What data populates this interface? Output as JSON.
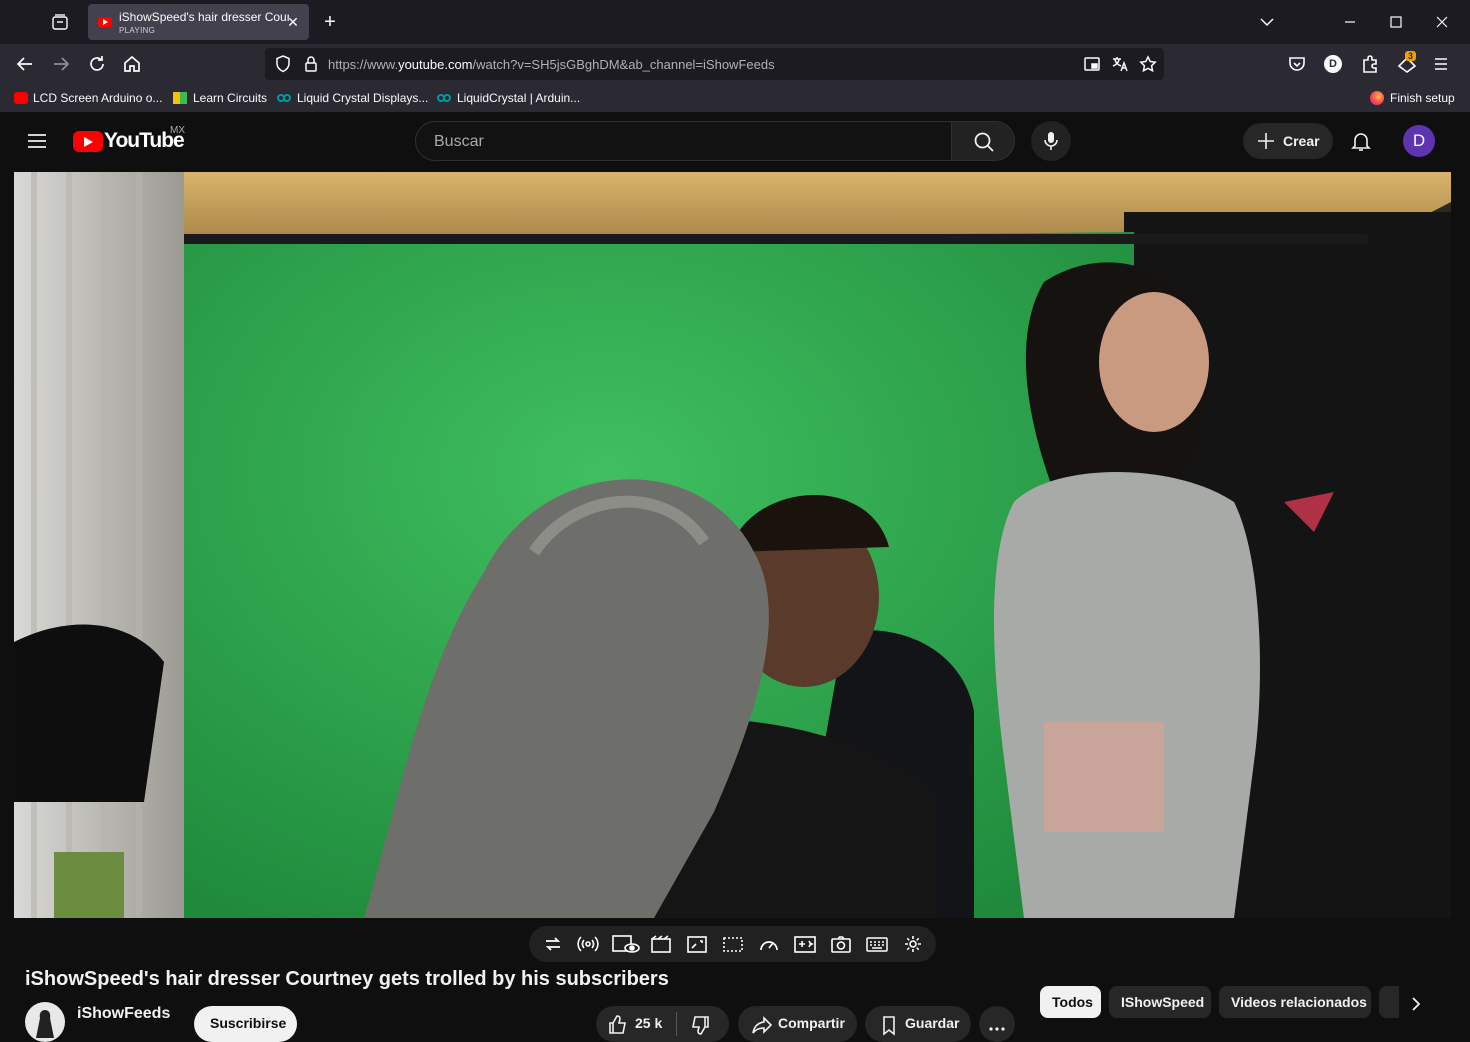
{
  "browser": {
    "tab": {
      "title": "iShowSpeed's hair dresser Courtney gets trolled by his subscribers",
      "status": "PLAYING"
    },
    "url": {
      "prefix": "https://www.",
      "domain": "youtube.com",
      "path": "/watch?v=SH5jsGBghDM&ab_channel=iShowFeeds"
    },
    "account_initial": "D",
    "extension_badge": "3",
    "bookmarks": [
      {
        "label": "LCD Screen Arduino o...",
        "icon": "youtube-favicon"
      },
      {
        "label": "Learn Circuits",
        "icon": "learn-circuits-favicon"
      },
      {
        "label": "Liquid Crystal Displays...",
        "icon": "arduino-favicon"
      },
      {
        "label": "LiquidCrystal | Arduin...",
        "icon": "arduino-favicon"
      }
    ],
    "finish_setup": "Finish setup"
  },
  "youtube": {
    "logo_text": "YouTube",
    "country_code": "MX",
    "search_placeholder": "Buscar",
    "create_label": "Crear",
    "avatar_initial": "D"
  },
  "video": {
    "title": "iShowSpeed's hair dresser Courtney gets trolled by his subscribers",
    "channel": "iShowFeeds",
    "subscribe_label": "Suscribirse",
    "likes": "25 k",
    "share_label": "Compartir",
    "save_label": "Guardar"
  },
  "chips": [
    "Todos",
    "IShowSpeed",
    "Videos relacionados"
  ],
  "colors": {
    "youtube_red": "#ff0000",
    "background": "#0f0f0f",
    "avatar": "#5e35b1",
    "chip_active": "#f1f1f1"
  }
}
